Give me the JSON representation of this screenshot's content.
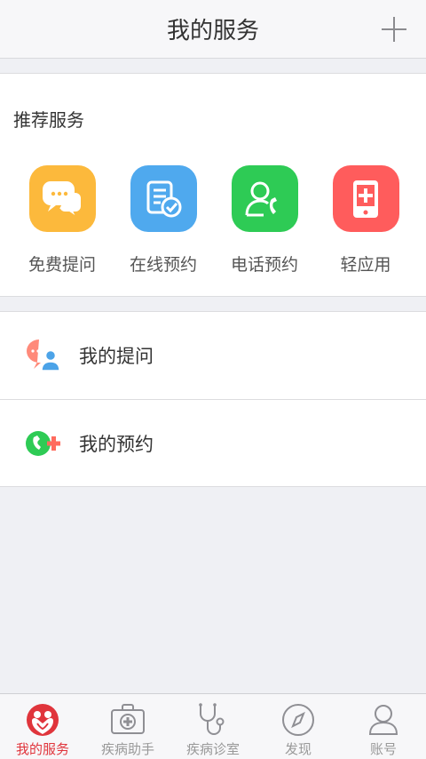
{
  "header": {
    "title": "我的服务"
  },
  "recommend": {
    "title": "推荐服务",
    "items": [
      {
        "label": "免费提问",
        "color": "#fcb93c",
        "icon": "chat-bubbles-icon"
      },
      {
        "label": "在线预约",
        "color": "#4fa9ee",
        "icon": "document-check-icon"
      },
      {
        "label": "电话预约",
        "color": "#2ecb55",
        "icon": "phone-user-icon"
      },
      {
        "label": "轻应用",
        "color": "#ff5c5c",
        "icon": "medical-phone-icon"
      }
    ]
  },
  "list": [
    {
      "label": "我的提问",
      "icon": "question-user-icon"
    },
    {
      "label": "我的预约",
      "icon": "appointment-phone-icon"
    }
  ],
  "tabbar": {
    "active_color": "#e0353c",
    "items": [
      {
        "label": "我的服务",
        "icon": "heart-people-icon",
        "active": true
      },
      {
        "label": "疾病助手",
        "icon": "medical-kit-icon",
        "active": false
      },
      {
        "label": "疾病诊室",
        "icon": "stethoscope-icon",
        "active": false
      },
      {
        "label": "发现",
        "icon": "compass-icon",
        "active": false
      },
      {
        "label": "账号",
        "icon": "person-icon",
        "active": false
      }
    ]
  }
}
